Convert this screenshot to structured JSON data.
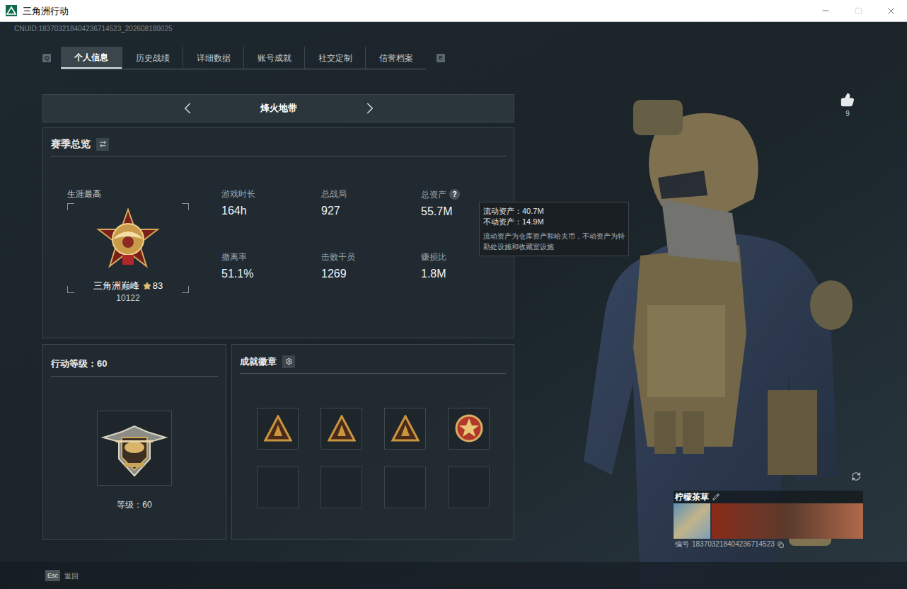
{
  "window": {
    "title": "三角洲行动"
  },
  "cnuid": "CNUID:183703218404236714523_202608180025",
  "tabs": {
    "prev_key": "Q",
    "next_key": "E",
    "items": [
      {
        "label": "个人信息",
        "selected": true
      },
      {
        "label": "历史战绩",
        "selected": false
      },
      {
        "label": "详细数据",
        "selected": false
      },
      {
        "label": "账号成就",
        "selected": false
      },
      {
        "label": "社交定制",
        "selected": false
      },
      {
        "label": "信誉档案",
        "selected": false
      }
    ]
  },
  "mode": {
    "label": "烽火地带"
  },
  "season": {
    "title": "赛季总览",
    "rank": {
      "caption": "生涯最高",
      "name": "三角洲巅峰",
      "stars": "83",
      "score": "10122"
    },
    "stats": [
      {
        "label": "游戏时长",
        "value": "164h",
        "help": false
      },
      {
        "label": "总战局",
        "value": "927",
        "help": false
      },
      {
        "label": "总资产",
        "value": "55.7M",
        "help": true
      },
      {
        "label": "撤离率",
        "value": "51.1%",
        "help": false
      },
      {
        "label": "击败干员",
        "value": "1269",
        "help": false
      },
      {
        "label": "赚损比",
        "value": "1.8M",
        "help": false
      }
    ],
    "help_glyph": "?"
  },
  "tooltip": {
    "lines": [
      "流动资产：40.7M",
      "不动资产：14.9M"
    ],
    "note": "流动资产为仓库资产和哈夫币，不动资产为特勤处设施和收藏室设施"
  },
  "level": {
    "title": "行动等级：60",
    "caption": "等级：60"
  },
  "badges": {
    "title": "成就徽章",
    "slots": [
      {
        "kind": "triangle",
        "color": "#c9963e"
      },
      {
        "kind": "triangle",
        "color": "#c9963e"
      },
      {
        "kind": "triangle",
        "color": "#c9963e"
      },
      {
        "kind": "medal",
        "color": "#b3382c"
      },
      {
        "kind": "empty",
        "color": "#3a444b"
      },
      {
        "kind": "empty",
        "color": "#3a444b"
      },
      {
        "kind": "empty",
        "color": "#3a444b"
      },
      {
        "kind": "empty",
        "color": "#3a444b"
      }
    ]
  },
  "likes": {
    "count": "9"
  },
  "card": {
    "name": "柠檬茶草",
    "id_label": "编号",
    "id": "183703218404236714523"
  },
  "footer": {
    "key": "Esc",
    "label": "返回"
  }
}
